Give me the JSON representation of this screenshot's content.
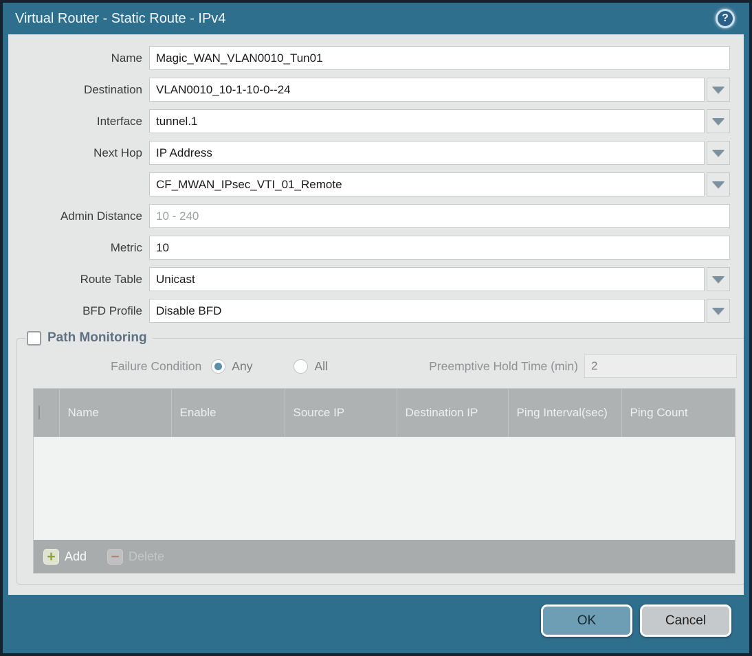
{
  "dialog": {
    "title": "Virtual Router - Static Route - IPv4"
  },
  "icons": {
    "help": "?",
    "add_plus": "+",
    "delete_minus": "−"
  },
  "colors": {
    "titlebar": "#2f6f8e",
    "outer_border": "#16222d",
    "content_bg": "#e5e6e6",
    "table_header_bg": "#aeb2b3",
    "table_footer_bg": "#a8acad",
    "ok_button": "#6d9eb4",
    "cancel_button": "#c6c9cb",
    "add_icon_green": "#8ba03a",
    "delete_icon_red": "#b2675c",
    "radio_dot": "#5b8fa7"
  },
  "form": {
    "fields": [
      {
        "label": "Name",
        "value": "Magic_WAN_VLAN0010_Tun01",
        "type": "text"
      },
      {
        "label": "Destination",
        "value": "VLAN0010_10-1-10-0--24",
        "type": "dropdown"
      },
      {
        "label": "Interface",
        "value": "tunnel.1",
        "type": "dropdown"
      },
      {
        "label": "Next Hop",
        "value": "IP Address",
        "type": "dropdown"
      },
      {
        "label": "",
        "value": "CF_MWAN_IPsec_VTI_01_Remote",
        "type": "dropdown"
      },
      {
        "label": "Admin Distance",
        "value": "",
        "placeholder": "10 - 240",
        "type": "text"
      },
      {
        "label": "Metric",
        "value": "10",
        "type": "text"
      },
      {
        "label": "Route Table",
        "value": "Unicast",
        "type": "dropdown"
      },
      {
        "label": "BFD Profile",
        "value": "Disable BFD",
        "type": "dropdown"
      }
    ]
  },
  "path_monitoring": {
    "title": "Path Monitoring",
    "enabled": false,
    "failure_condition": {
      "label": "Failure Condition",
      "options": [
        {
          "label": "Any",
          "selected": true
        },
        {
          "label": "All",
          "selected": false
        }
      ]
    },
    "preemptive_hold": {
      "label": "Preemptive Hold Time (min)",
      "value": "2"
    },
    "table": {
      "columns": [
        "Name",
        "Enable",
        "Source IP",
        "Destination IP",
        "Ping Interval(sec)",
        "Ping Count"
      ],
      "rows": []
    },
    "actions": {
      "add": "Add",
      "delete": "Delete"
    }
  },
  "footer": {
    "ok": "OK",
    "cancel": "Cancel"
  }
}
